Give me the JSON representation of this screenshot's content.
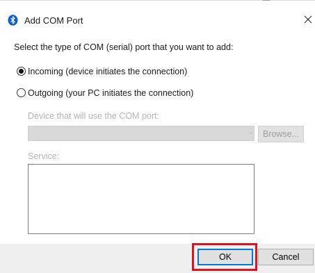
{
  "window": {
    "title": "Add COM Port",
    "icon": "bluetooth-icon",
    "close_icon": "close-icon"
  },
  "prompt": "Select the type of COM (serial) port that you want to add:",
  "options": [
    {
      "label": "Incoming (device initiates the connection)",
      "checked": true
    },
    {
      "label": "Outgoing (your PC initiates the connection)",
      "checked": false
    }
  ],
  "device": {
    "label": "Device that will use the COM port:",
    "value": "",
    "browse_label": "Browse..."
  },
  "service": {
    "label": "Service:",
    "value": ""
  },
  "buttons": {
    "ok_label": "OK",
    "cancel_label": "Cancel"
  },
  "colors": {
    "accent": "#0078d7",
    "highlight": "#e0141e",
    "disabled_text": "#b3b3b3"
  }
}
